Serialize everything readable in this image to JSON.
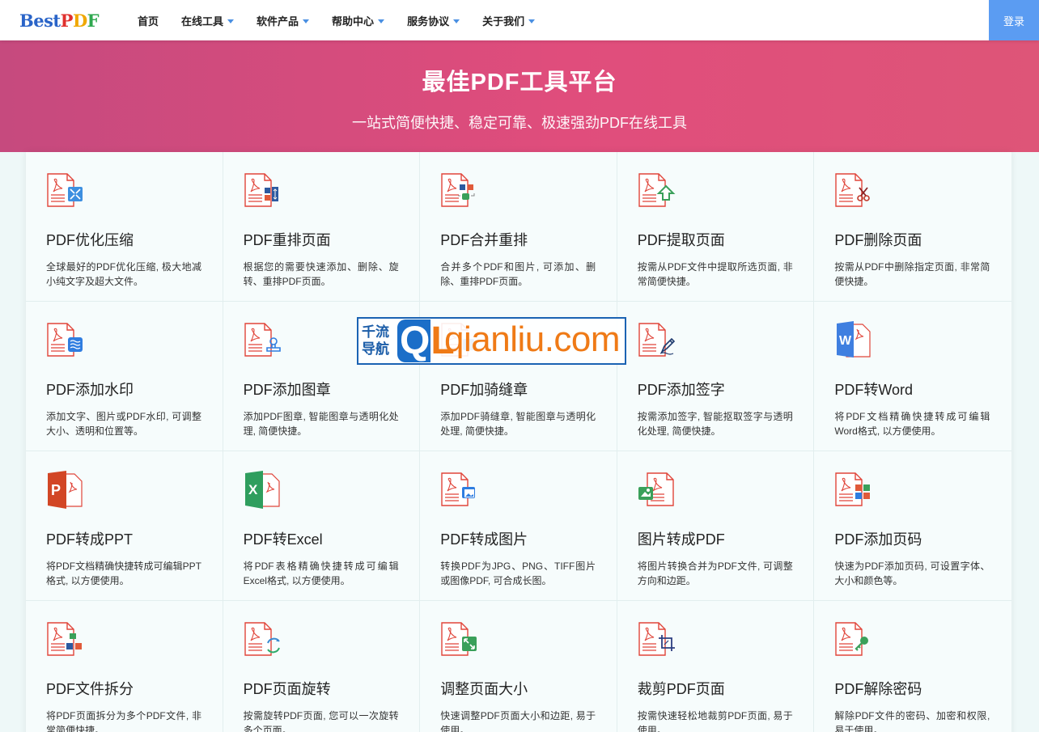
{
  "header": {
    "logo": {
      "b": "Best",
      "p": "P",
      "d": "D",
      "f": "F"
    },
    "nav": [
      {
        "label": "首页",
        "caret": false
      },
      {
        "label": "在线工具",
        "caret": true
      },
      {
        "label": "软件产品",
        "caret": true
      },
      {
        "label": "帮助中心",
        "caret": true
      },
      {
        "label": "服务协议",
        "caret": true
      },
      {
        "label": "关于我们",
        "caret": true
      }
    ],
    "login_label": "登录"
  },
  "banner": {
    "title": "最佳PDF工具平台",
    "subtitle": "一站式简便快捷、稳定可靠、极速强劲PDF在线工具"
  },
  "tools": [
    {
      "title": "PDF优化压缩",
      "desc": "全球最好的PDF优化压缩, 极大地减小纯文字及超大文件。",
      "icon": "compress-icon"
    },
    {
      "title": "PDF重排页面",
      "desc": "根据您的需要快速添加、删除、旋转、重排PDF页面。",
      "icon": "reorder-pages-icon"
    },
    {
      "title": "PDF合并重排",
      "desc": "合并多个PDF和图片, 可添加、删除、重排PDF页面。",
      "icon": "merge-icon"
    },
    {
      "title": "PDF提取页面",
      "desc": "按需从PDF文件中提取所选页面, 非常简便快捷。",
      "icon": "extract-page-icon"
    },
    {
      "title": "PDF删除页面",
      "desc": "按需从PDF中删除指定页面, 非常简便快捷。",
      "icon": "delete-page-icon"
    },
    {
      "title": "PDF添加水印",
      "desc": "添加文字、图片或PDF水印, 可调整大小、透明和位置等。",
      "icon": "watermark-icon"
    },
    {
      "title": "PDF添加图章",
      "desc": "添加PDF图章, 智能图章与透明化处理, 简便快捷。",
      "icon": "stamp-icon"
    },
    {
      "title": "PDF加骑缝章",
      "desc": "添加PDF骑缝章, 智能图章与透明化处理, 简便快捷。",
      "icon": "seam-stamp-icon"
    },
    {
      "title": "PDF添加签字",
      "desc": "按需添加签字, 智能抠取签字与透明化处理, 简便快捷。",
      "icon": "signature-icon"
    },
    {
      "title": "PDF转Word",
      "desc": "将PDF文档精确快捷转成可编辑Word格式, 以方便使用。",
      "icon": "word-icon"
    },
    {
      "title": "PDF转成PPT",
      "desc": "将PDF文档精确快捷转成可编辑PPT格式, 以方便使用。",
      "icon": "ppt-icon"
    },
    {
      "title": "PDF转Excel",
      "desc": "将PDF表格精确快捷转成可编辑Excel格式, 以方便使用。",
      "icon": "excel-icon"
    },
    {
      "title": "PDF转成图片",
      "desc": "转换PDF为JPG、PNG、TIFF图片或图像PDF, 可合成长图。",
      "icon": "pdf-to-image-icon"
    },
    {
      "title": "图片转成PDF",
      "desc": "将图片转换合并为PDF文件, 可调整方向和边距。",
      "icon": "image-to-pdf-icon"
    },
    {
      "title": "PDF添加页码",
      "desc": "快速为PDF添加页码, 可设置字体、大小和颜色等。",
      "icon": "page-number-icon"
    },
    {
      "title": "PDF文件拆分",
      "desc": "将PDF页面拆分为多个PDF文件, 非常简便快捷。",
      "icon": "split-icon"
    },
    {
      "title": "PDF页面旋转",
      "desc": "按需旋转PDF页面, 您可以一次旋转多个页面。",
      "icon": "rotate-icon"
    },
    {
      "title": "调整页面大小",
      "desc": "快速调整PDF页面大小和边距, 易于使用。",
      "icon": "resize-icon"
    },
    {
      "title": "裁剪PDF页面",
      "desc": "按需快速轻松地裁剪PDF页面, 易于使用。",
      "icon": "crop-icon"
    },
    {
      "title": "PDF解除密码",
      "desc": "解除PDF文件的密码、加密和权限, 易于使用。",
      "icon": "unlock-icon"
    }
  ],
  "watermark": {
    "cn_line1": "千流",
    "cn_line2": "导航",
    "ql_q": "Q",
    "ql_l": "L",
    "domain": "qianliu.com"
  }
}
